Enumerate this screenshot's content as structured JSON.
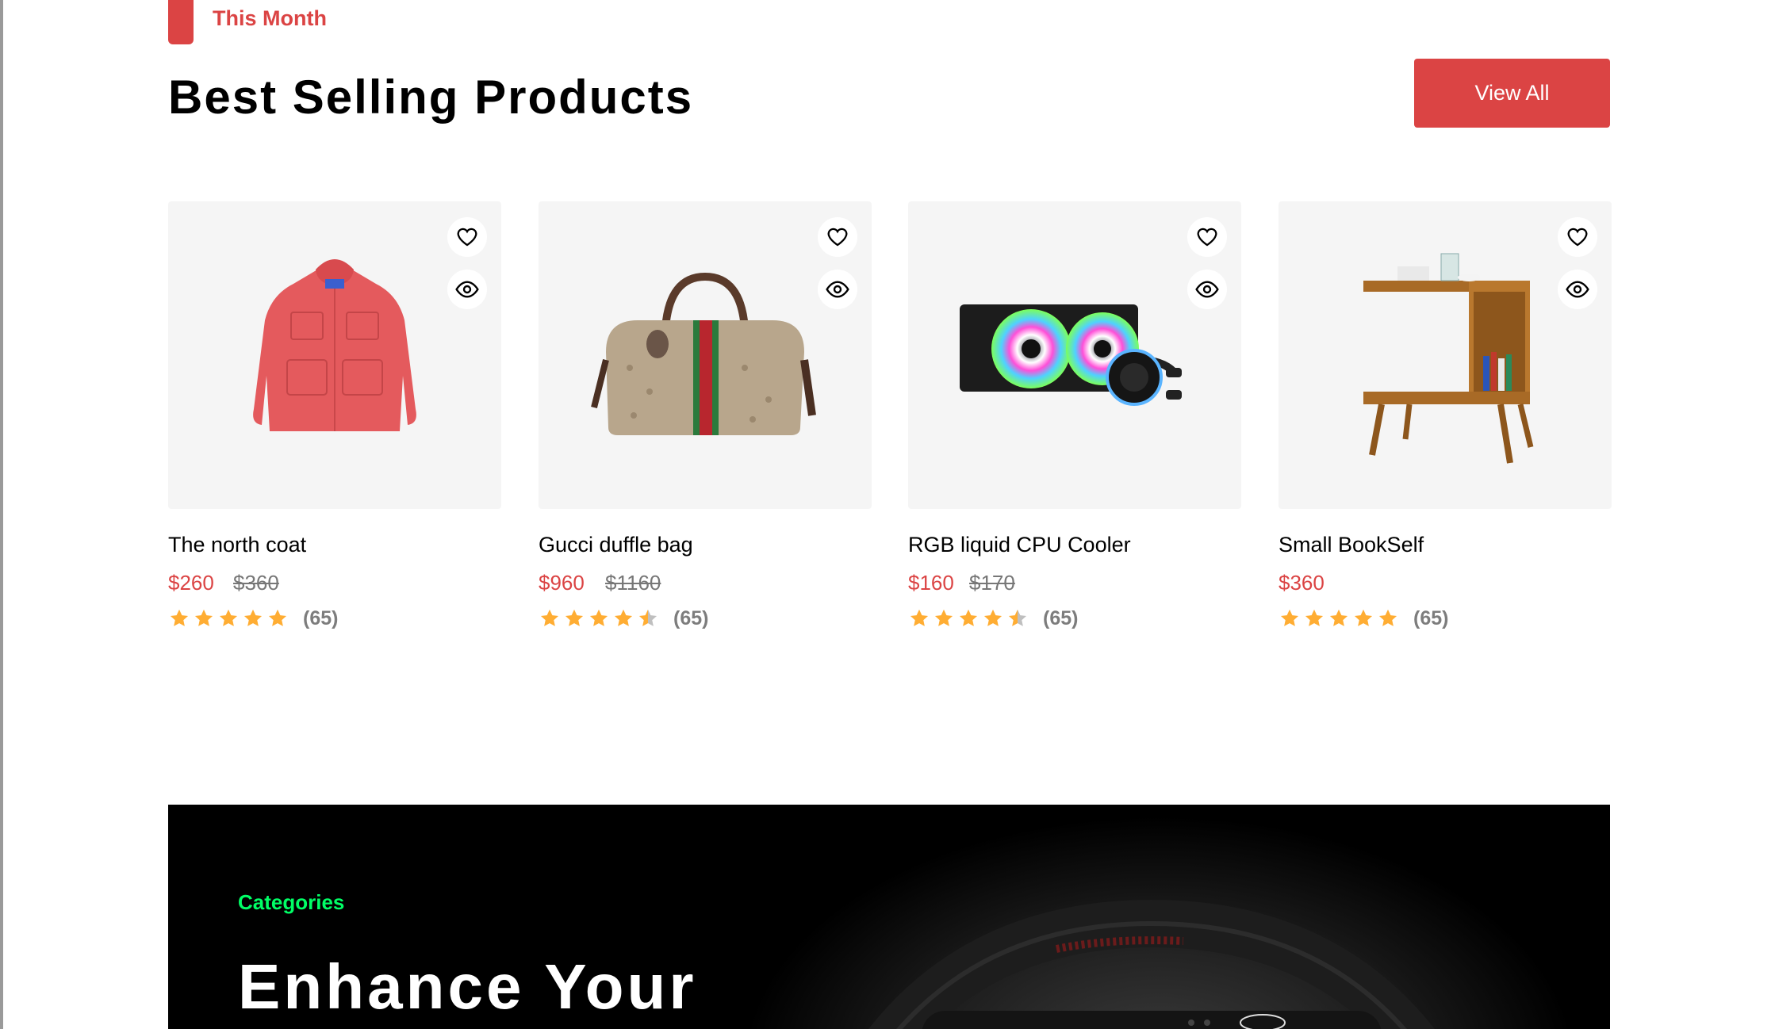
{
  "section": {
    "tag": "This Month",
    "title": "Best Selling Products",
    "view_all_label": "View All"
  },
  "products": [
    {
      "name": "The north coat",
      "price": "$260",
      "old_price": "$360",
      "rating": 5,
      "reviews": "(65)"
    },
    {
      "name": "Gucci duffle bag",
      "price": "$960",
      "old_price": "$1160",
      "rating": 4.5,
      "reviews": "(65)"
    },
    {
      "name": "RGB liquid CPU Cooler",
      "price": "$160",
      "old_price": "$170",
      "rating": 4.5,
      "reviews": "(65)"
    },
    {
      "name": "Small BookSelf",
      "price": "$360",
      "old_price": "",
      "rating": 5,
      "reviews": "(65)"
    }
  ],
  "banner": {
    "tag": "Categories",
    "heading": "Enhance Your"
  },
  "colors": {
    "accent": "#db4444",
    "star": "#ffad33",
    "star_empty": "#bfbfbf",
    "banner_tag": "#00ff66"
  },
  "icons": [
    "heart-icon",
    "eye-icon",
    "star-icon"
  ]
}
